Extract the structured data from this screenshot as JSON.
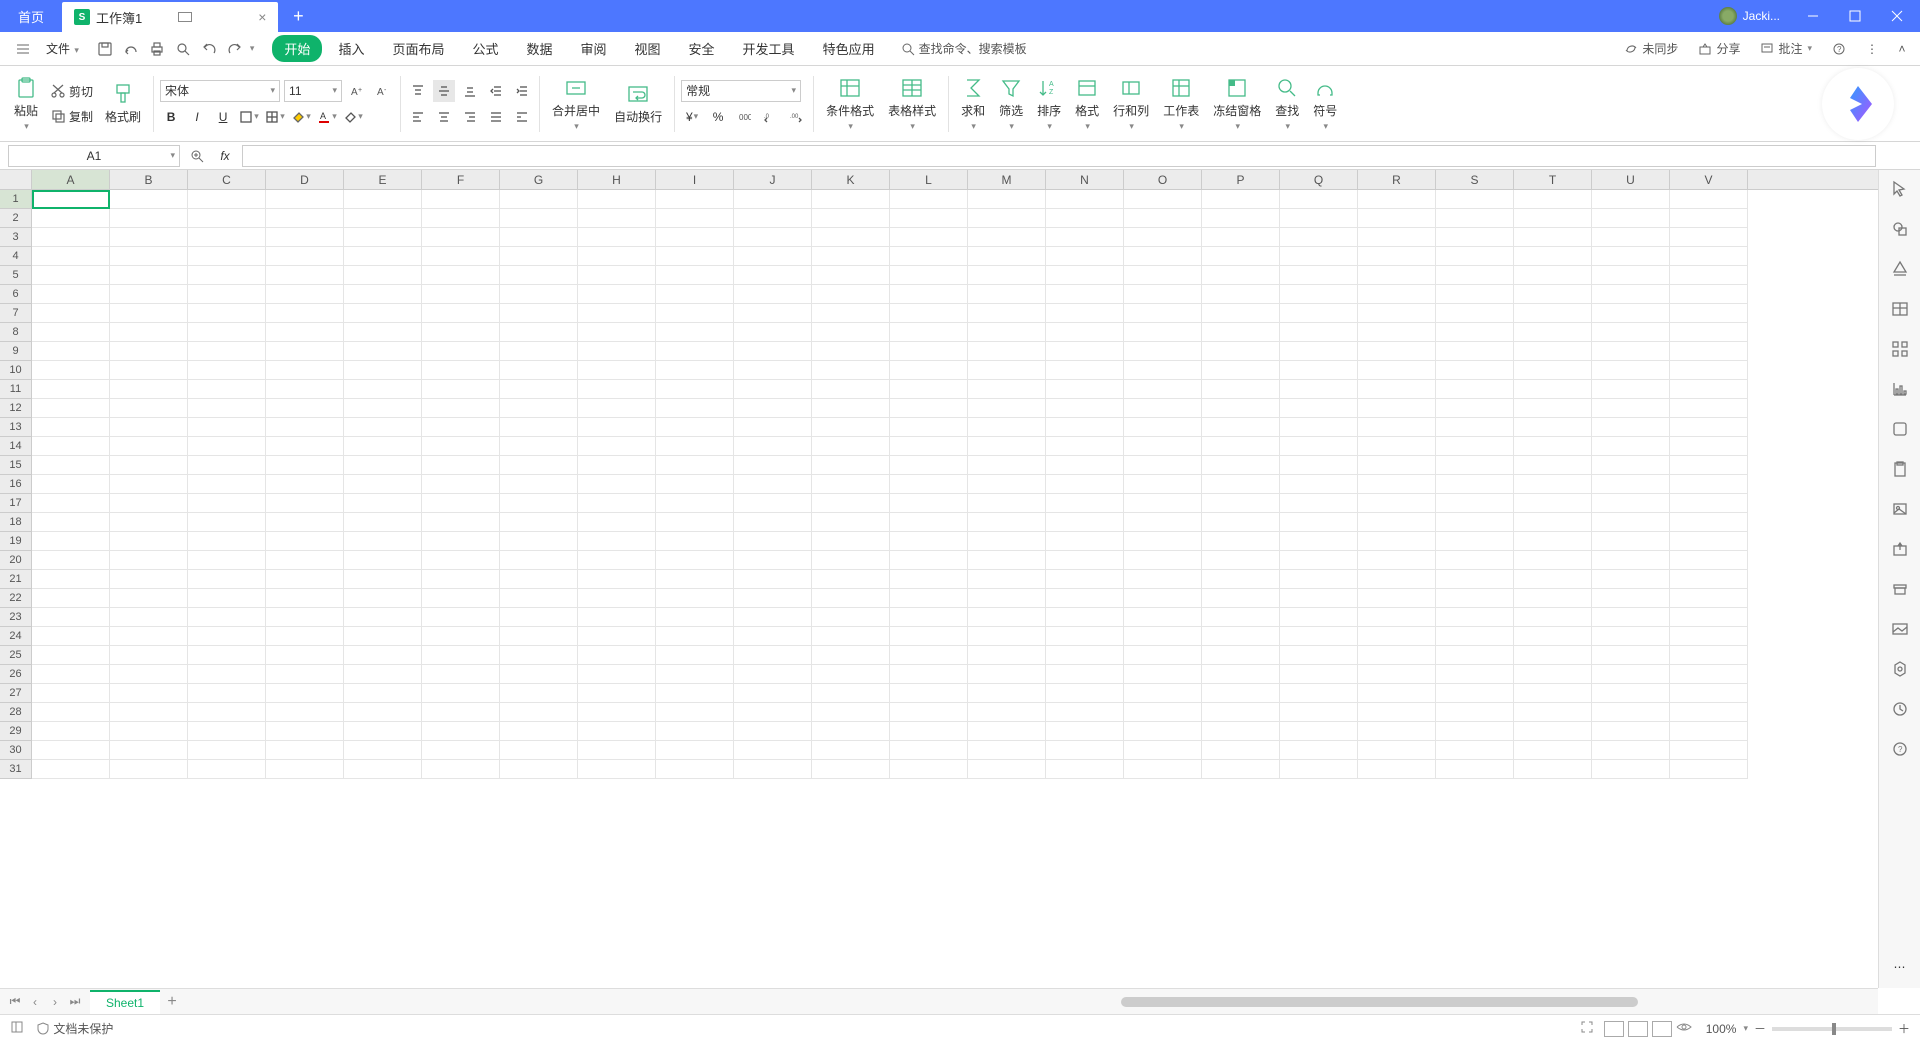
{
  "titlebar": {
    "home_tab": "首页",
    "doc_tab": "工作簿1",
    "user": "Jacki..."
  },
  "menubar": {
    "file": "文件",
    "tabs": [
      "开始",
      "插入",
      "页面布局",
      "公式",
      "数据",
      "审阅",
      "视图",
      "安全",
      "开发工具",
      "特色应用"
    ],
    "search": "查找命令、搜索模板",
    "sync": "未同步",
    "share": "分享",
    "annotate": "批注"
  },
  "ribbon": {
    "paste": "粘贴",
    "cut": "剪切",
    "copy": "复制",
    "format_painter": "格式刷",
    "font_name": "宋体",
    "font_size": "11",
    "merge": "合并居中",
    "wrap": "自动换行",
    "number_format": "常规",
    "cond_fmt": "条件格式",
    "table_style": "表格样式",
    "sum": "求和",
    "filter": "筛选",
    "sort": "排序",
    "format": "格式",
    "rowcol": "行和列",
    "worksheet": "工作表",
    "freeze": "冻结窗格",
    "find": "查找",
    "symbol": "符号"
  },
  "fxbar": {
    "namebox": "A1",
    "formula": ""
  },
  "grid": {
    "columns": [
      "A",
      "B",
      "C",
      "D",
      "E",
      "F",
      "G",
      "H",
      "I",
      "J",
      "K",
      "L",
      "M",
      "N",
      "O",
      "P",
      "Q",
      "R",
      "S",
      "T",
      "U",
      "V"
    ],
    "rows": 31,
    "active_cell": "A1"
  },
  "sheetbar": {
    "sheet": "Sheet1"
  },
  "statusbar": {
    "protect": "文档未保护",
    "zoom": "100%"
  }
}
